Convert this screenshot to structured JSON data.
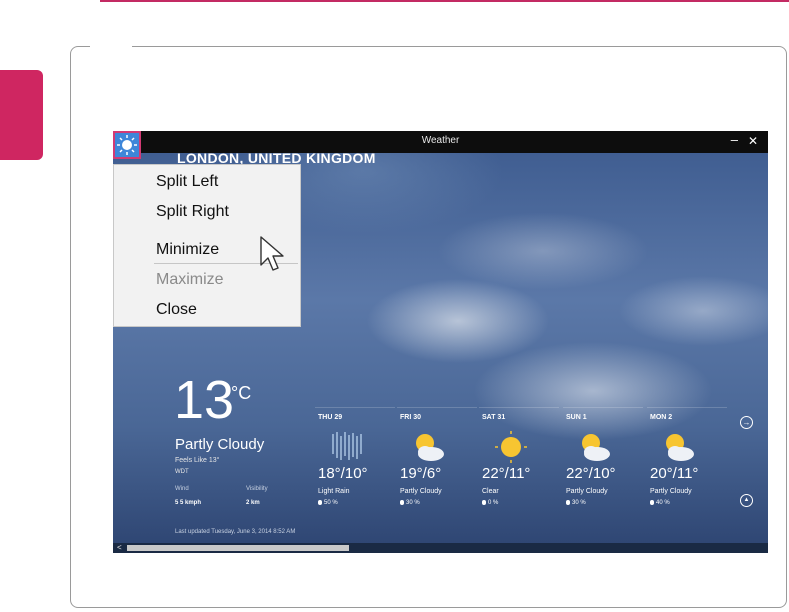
{
  "window": {
    "title": "Weather",
    "minimize_glyph": "–",
    "close_glyph": "✕",
    "system_icon": "sun-icon"
  },
  "location": "LONDON, UNITED KINGDOM",
  "context_menu": {
    "items": [
      {
        "label": "Split Left",
        "enabled": true
      },
      {
        "label": "Split Right",
        "enabled": true
      },
      {
        "label": "Minimize",
        "enabled": true
      },
      {
        "label": "Maximize",
        "enabled": false
      },
      {
        "label": "Close",
        "enabled": true
      }
    ]
  },
  "current": {
    "temp": "13",
    "unit": "°C",
    "condition": "Partly Cloudy",
    "feels_like": "Feels Like 13°",
    "source": "WDT",
    "wind_label": "Wind",
    "wind_value": "5 5 kmph",
    "visibility_label": "Visibility",
    "visibility_value": "2 km",
    "last_updated": "Last updated Tuesday, June 3, 2014 8:52 AM"
  },
  "forecast": [
    {
      "day": "THU 29",
      "icon": "rain-icon",
      "temp": "18°/10°",
      "condition": "Light Rain",
      "precip": "50 %"
    },
    {
      "day": "FRI 30",
      "icon": "partly-cloudy-icon",
      "temp": "19°/6°",
      "condition": "Partly Cloudy",
      "precip": "30 %"
    },
    {
      "day": "SAT 31",
      "icon": "sun-icon",
      "temp": "22°/11°",
      "condition": "Clear",
      "precip": "0 %"
    },
    {
      "day": "SUN 1",
      "icon": "partly-cloudy-icon",
      "temp": "22°/10°",
      "condition": "Partly Cloudy",
      "precip": "30 %"
    },
    {
      "day": "MON 2",
      "icon": "partly-cloudy-icon",
      "temp": "20°/11°",
      "condition": "Partly Cloudy",
      "precip": "40 %"
    }
  ],
  "nav": {
    "next_glyph": "→",
    "up_glyph": "▲",
    "scroll_left_glyph": "<"
  },
  "colors": {
    "accent": "#cf2661",
    "system_icon_bg": "#3e86d9",
    "titlebar": "#0d0d0d"
  }
}
